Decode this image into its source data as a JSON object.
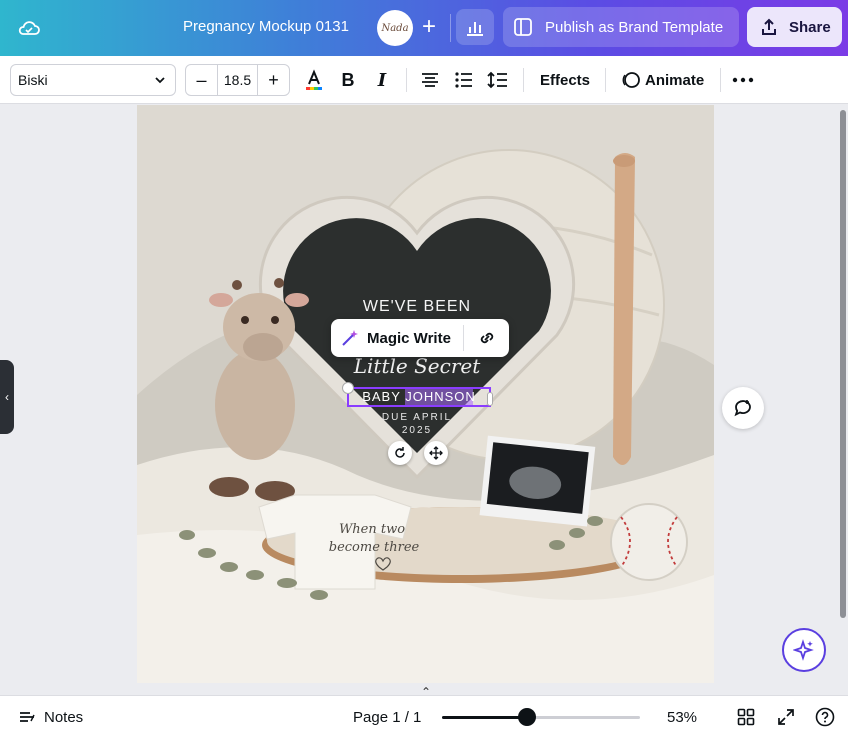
{
  "header": {
    "doc_title": "Pregnancy Mockup 0131",
    "avatar_text": "Nada",
    "publish_label": "Publish as Brand Template",
    "share_label": "Share"
  },
  "toolbar": {
    "font_name": "Biski",
    "font_size": "18.5",
    "effects_label": "Effects",
    "animate_label": "Animate"
  },
  "canvas": {
    "magic_write_label": "Magic Write",
    "letterboard_line1": "WE'VE BEEN",
    "letterboard_script": "Little Secret",
    "selected_text": "BABY JOHNSON",
    "due_line1": "DUE APRIL",
    "due_line2": "2025",
    "onesie_text_1": "When two",
    "onesie_text_2": "become three"
  },
  "footer": {
    "notes_label": "Notes",
    "page_indicator": "Page 1 / 1",
    "zoom_value": "53%",
    "zoom_fraction": 0.43
  },
  "colors": {
    "accent": "#8b3dff",
    "header_gradient_start": "#2fb6ce",
    "header_gradient_end": "#7b3be6"
  }
}
